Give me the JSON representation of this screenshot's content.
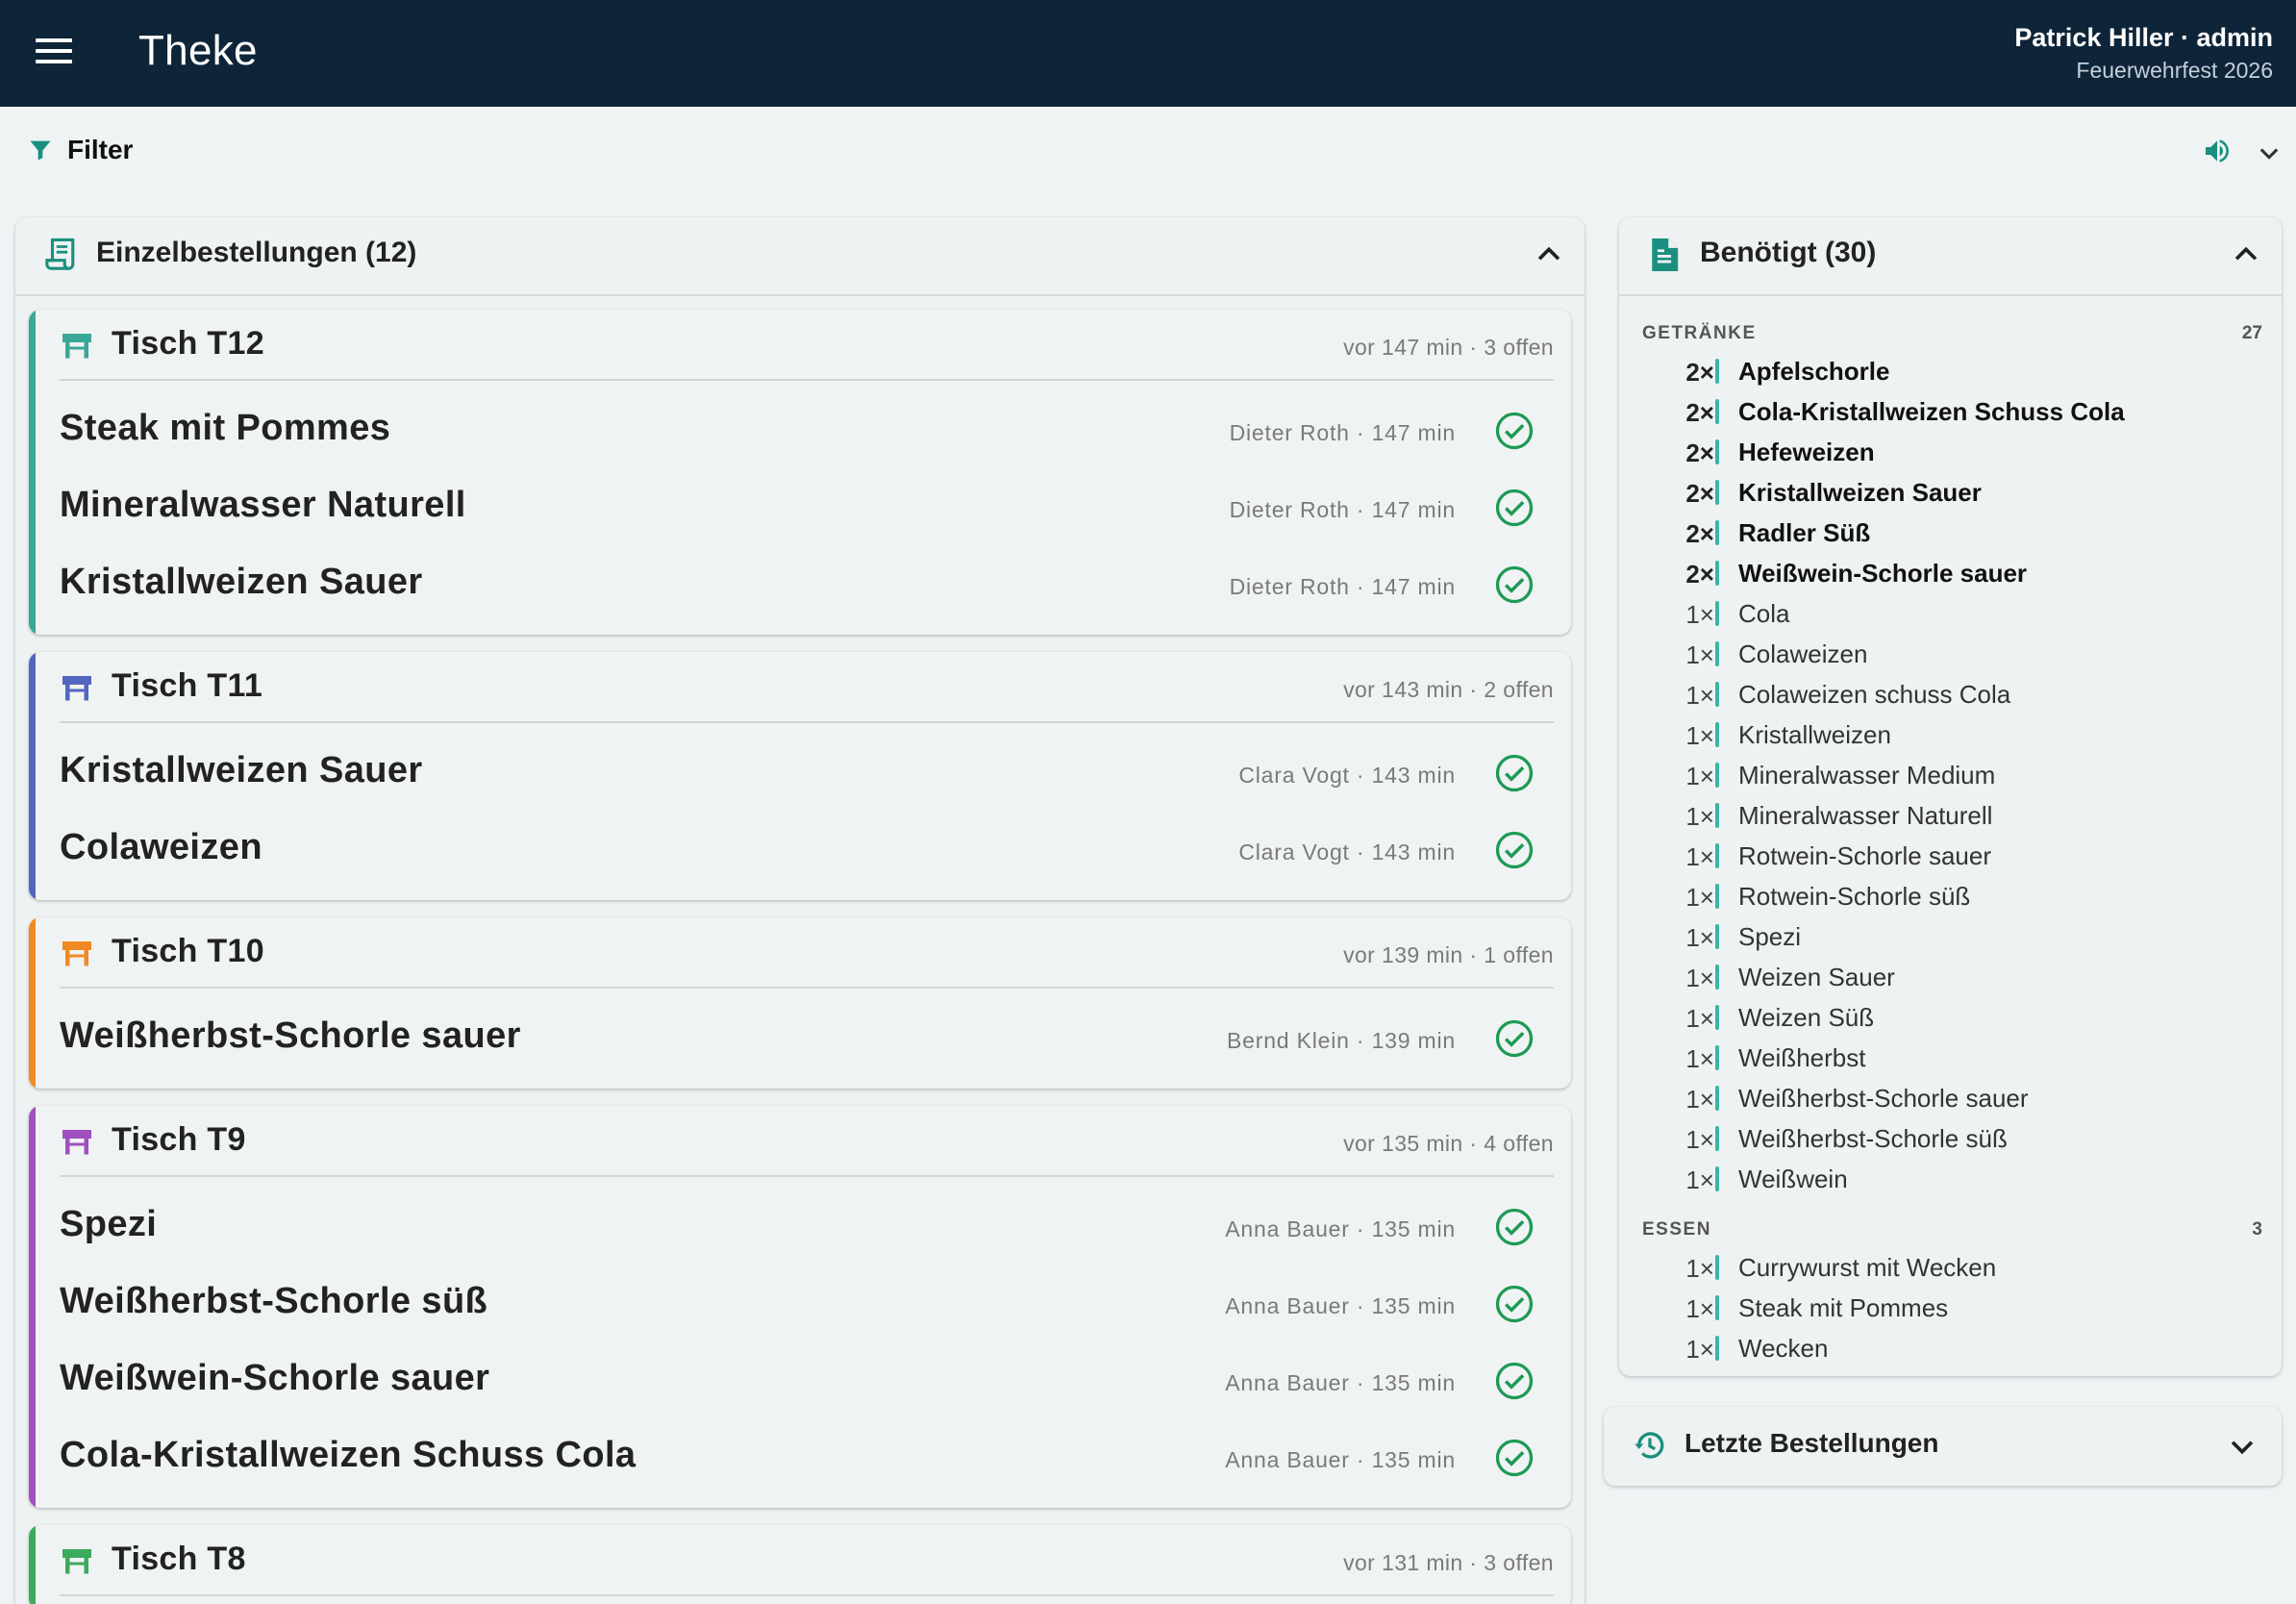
{
  "app": {
    "title": "Theke",
    "user": "Patrick Hiller · admin",
    "event": "Feuerwehrfest 2026"
  },
  "filter": {
    "label": "Filter"
  },
  "colors": {
    "appbar": "#0e2438",
    "accent": "#1a8f7f",
    "done": "#1e9a55"
  },
  "orders_panel": {
    "title": "Einzelbestellungen (12)",
    "tables": [
      {
        "name": "Tisch T12",
        "meta": "vor 147 min · 3 offen",
        "color": "#3aa896",
        "items": [
          {
            "name": "Steak mit Pommes",
            "meta": "Dieter Roth · 147 min"
          },
          {
            "name": "Mineralwasser Naturell",
            "meta": "Dieter Roth · 147 min"
          },
          {
            "name": "Kristallweizen Sauer",
            "meta": "Dieter Roth · 147 min"
          }
        ]
      },
      {
        "name": "Tisch T11",
        "meta": "vor 143 min · 2 offen",
        "color": "#5266c0",
        "items": [
          {
            "name": "Kristallweizen Sauer",
            "meta": "Clara Vogt · 143 min"
          },
          {
            "name": "Colaweizen",
            "meta": "Clara Vogt · 143 min"
          }
        ]
      },
      {
        "name": "Tisch T10",
        "meta": "vor 139 min · 1 offen",
        "color": "#f08a24",
        "items": [
          {
            "name": "Weißherbst-Schorle sauer",
            "meta": "Bernd Klein · 139 min"
          }
        ]
      },
      {
        "name": "Tisch T9",
        "meta": "vor 135 min · 4 offen",
        "color": "#a050c0",
        "items": [
          {
            "name": "Spezi",
            "meta": "Anna Bauer · 135 min"
          },
          {
            "name": "Weißherbst-Schorle süß",
            "meta": "Anna Bauer · 135 min"
          },
          {
            "name": "Weißwein-Schorle sauer",
            "meta": "Anna Bauer · 135 min"
          },
          {
            "name": "Cola-Kristallweizen Schuss Cola",
            "meta": "Anna Bauer · 135 min"
          }
        ]
      },
      {
        "name": "Tisch T8",
        "meta": "vor 131 min · 3 offen",
        "color": "#3caa5c",
        "items": []
      }
    ]
  },
  "needed_panel": {
    "title": "Benötigt (30)",
    "categories": [
      {
        "name": "GETRÄNKE",
        "count": "27",
        "items": [
          {
            "qty": "2×",
            "name": "Apfelschorle",
            "bold": true
          },
          {
            "qty": "2×",
            "name": "Cola-Kristallweizen Schuss Cola",
            "bold": true
          },
          {
            "qty": "2×",
            "name": "Hefeweizen",
            "bold": true
          },
          {
            "qty": "2×",
            "name": "Kristallweizen Sauer",
            "bold": true
          },
          {
            "qty": "2×",
            "name": "Radler Süß",
            "bold": true
          },
          {
            "qty": "2×",
            "name": "Weißwein-Schorle sauer",
            "bold": true
          },
          {
            "qty": "1×",
            "name": "Cola",
            "bold": false
          },
          {
            "qty": "1×",
            "name": "Colaweizen",
            "bold": false
          },
          {
            "qty": "1×",
            "name": "Colaweizen schuss Cola",
            "bold": false
          },
          {
            "qty": "1×",
            "name": "Kristallweizen",
            "bold": false
          },
          {
            "qty": "1×",
            "name": "Mineralwasser Medium",
            "bold": false
          },
          {
            "qty": "1×",
            "name": "Mineralwasser Naturell",
            "bold": false
          },
          {
            "qty": "1×",
            "name": "Rotwein-Schorle sauer",
            "bold": false
          },
          {
            "qty": "1×",
            "name": "Rotwein-Schorle süß",
            "bold": false
          },
          {
            "qty": "1×",
            "name": "Spezi",
            "bold": false
          },
          {
            "qty": "1×",
            "name": "Weizen Sauer",
            "bold": false
          },
          {
            "qty": "1×",
            "name": "Weizen Süß",
            "bold": false
          },
          {
            "qty": "1×",
            "name": "Weißherbst",
            "bold": false
          },
          {
            "qty": "1×",
            "name": "Weißherbst-Schorle sauer",
            "bold": false
          },
          {
            "qty": "1×",
            "name": "Weißherbst-Schorle süß",
            "bold": false
          },
          {
            "qty": "1×",
            "name": "Weißwein",
            "bold": false
          }
        ]
      },
      {
        "name": "ESSEN",
        "count": "3",
        "items": [
          {
            "qty": "1×",
            "name": "Currywurst mit Wecken",
            "bold": false
          },
          {
            "qty": "1×",
            "name": "Steak mit Pommes",
            "bold": false
          },
          {
            "qty": "1×",
            "name": "Wecken",
            "bold": false
          }
        ]
      }
    ]
  },
  "recent_panel": {
    "title": "Letzte Bestellungen"
  }
}
